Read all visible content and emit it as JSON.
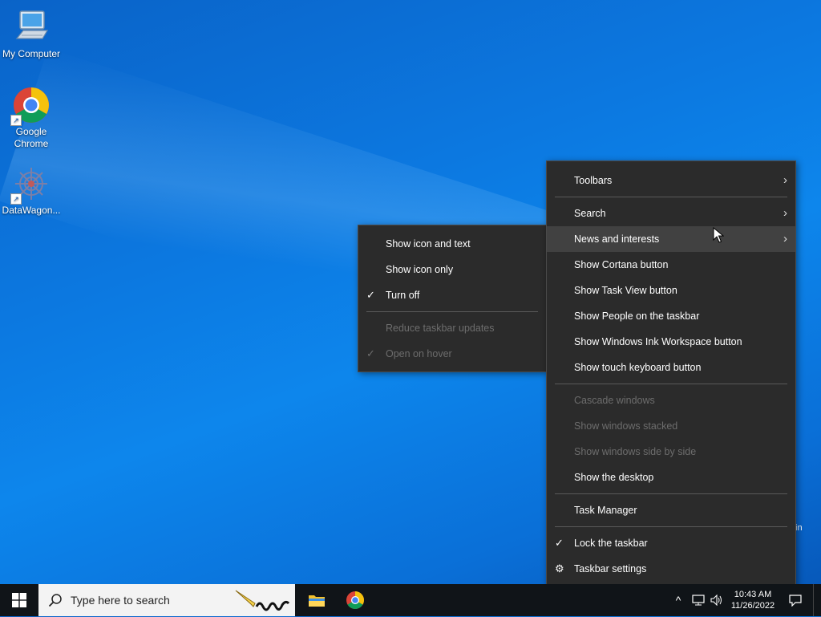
{
  "desktop": {
    "icons": [
      {
        "label": "My Computer",
        "icon": "computer-icon"
      },
      {
        "label": "Google Chrome",
        "icon": "chrome-icon"
      },
      {
        "label": "DataWagon...",
        "icon": "datawagon-icon"
      }
    ],
    "partial_watermark": "in"
  },
  "context_menu": {
    "items": {
      "toolbars": "Toolbars",
      "search": "Search",
      "news": "News and interests",
      "cortana": "Show Cortana button",
      "taskview": "Show Task View button",
      "people": "Show People on the taskbar",
      "ink": "Show Windows Ink Workspace button",
      "touch_kb": "Show touch keyboard button",
      "cascade": "Cascade windows",
      "stacked": "Show windows stacked",
      "side_by_side": "Show windows side by side",
      "desktop": "Show the desktop",
      "task_manager": "Task Manager",
      "lock": "Lock the taskbar",
      "settings": "Taskbar settings"
    }
  },
  "submenu": {
    "items": {
      "icon_text": "Show icon and text",
      "icon_only": "Show icon only",
      "turn_off": "Turn off",
      "reduce": "Reduce taskbar updates",
      "hover": "Open on hover"
    }
  },
  "taskbar": {
    "search_placeholder": "Type here to search",
    "clock_time": "10:43 AM",
    "clock_date": "11/26/2022"
  },
  "colors": {
    "menu_bg": "#2b2b2b",
    "taskbar_bg": "#101418",
    "desktop_blue": "#0c78e0"
  }
}
